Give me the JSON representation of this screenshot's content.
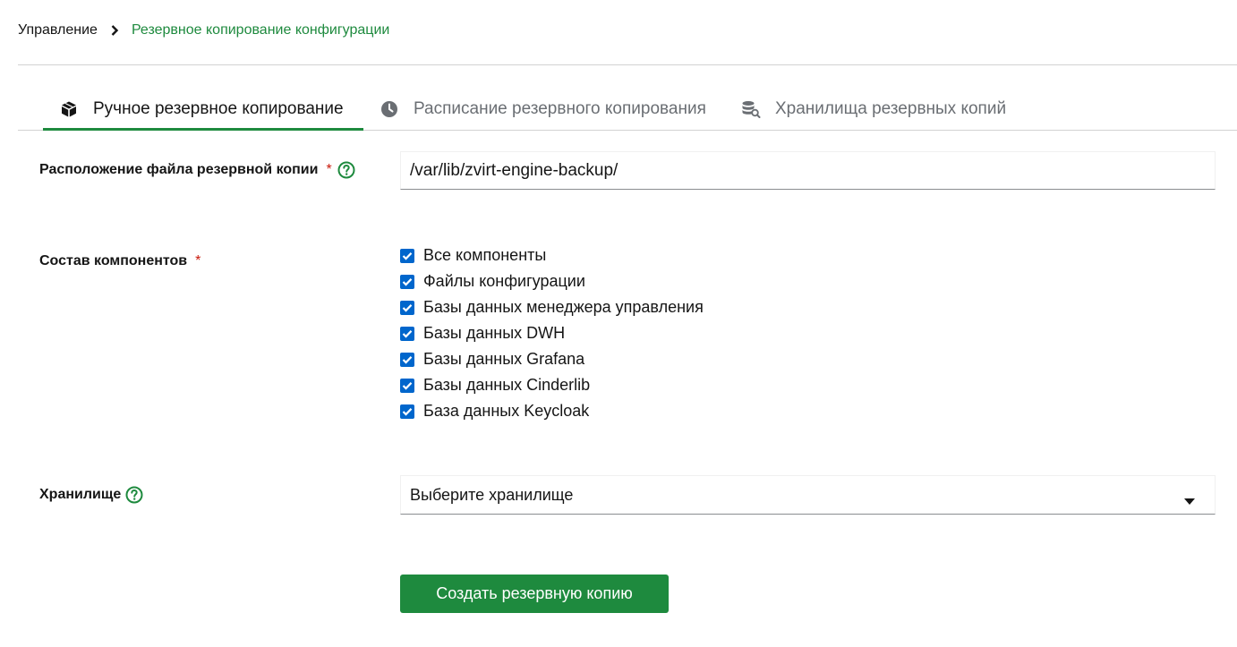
{
  "breadcrumb": {
    "root": "Управление",
    "current": "Резервное копирование конфигурации"
  },
  "tabs": [
    {
      "label": "Ручное резервное копирование",
      "icon": "box-icon",
      "active": true
    },
    {
      "label": "Расписание резервного копирования",
      "icon": "clock-icon",
      "active": false
    },
    {
      "label": "Хранилища резервных копий",
      "icon": "database-search-icon",
      "active": false
    }
  ],
  "form": {
    "location_label": "Расположение файла резервной копии",
    "location_value": "/var/lib/zvirt-engine-backup/",
    "required_mark": "*",
    "components_label": "Состав компонентов",
    "components": [
      {
        "label": "Все компоненты",
        "checked": true
      },
      {
        "label": "Файлы конфигурации",
        "checked": true
      },
      {
        "label": "Базы данных менеджера управления",
        "checked": true
      },
      {
        "label": "Базы данных DWH",
        "checked": true
      },
      {
        "label": "Базы данных Grafana",
        "checked": true
      },
      {
        "label": "Базы данных Cinderlib",
        "checked": true
      },
      {
        "label": "База данных Keycloak",
        "checked": true
      }
    ],
    "storage_label": "Хранилище",
    "storage_selected": "Выберите хранилище",
    "submit_label": "Создать резервную копию"
  },
  "colors": {
    "accent": "#1e8a3e",
    "checkbox": "#0066cc",
    "required": "#c9190b"
  }
}
